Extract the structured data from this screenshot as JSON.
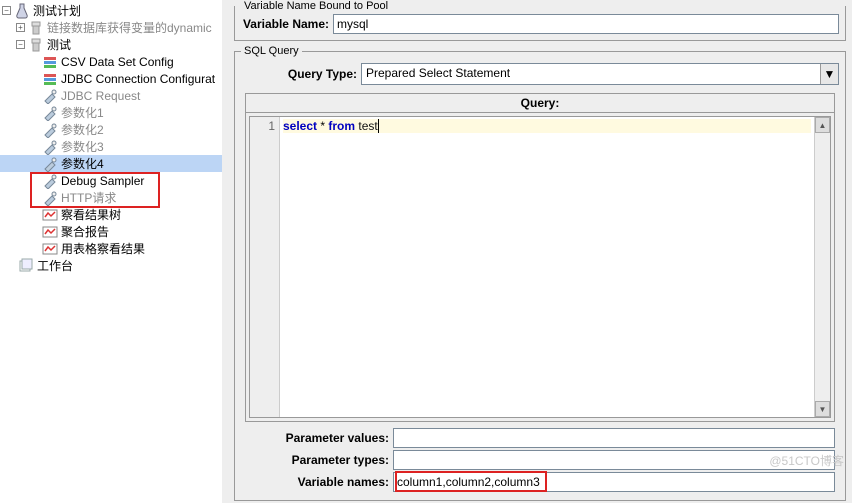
{
  "tree": {
    "root_label": "测试计划",
    "dynamic_label": "链接数据库获得变量的dynamic",
    "test_label": "测试",
    "csv_label": "CSV Data Set Config",
    "jdbc_conn_label": "JDBC Connection Configurat",
    "jdbc_req_label": "JDBC Request",
    "param1_label": "参数化1",
    "param2_label": "参数化2",
    "param3_label": "参数化3",
    "param4_label": "参数化4",
    "debug_label": "Debug Sampler",
    "http_label": "HTTP请求",
    "result_tree_label": "察看结果树",
    "aggregate_label": "聚合报告",
    "table_results_label": "用表格察看结果",
    "workbench_label": "工作台"
  },
  "pool_legend": "Variable Name Bound to Pool",
  "var_name_label": "Variable Name:",
  "var_name_value": "mysql",
  "sql_legend": "SQL Query",
  "query_type_label": "Query Type:",
  "query_type_value": "Prepared Select Statement",
  "query_header": "Query:",
  "gutter_1": "1",
  "code_kw1": "select",
  "code_op": " * ",
  "code_kw2": "from",
  "code_id": " test",
  "param_values_label": "Parameter values:",
  "param_values_value": "",
  "param_types_label": "Parameter types:",
  "param_types_value": "",
  "var_names_label": "Variable names:",
  "var_names_value": "column1,column2,column3",
  "watermark": "@51CTO博客"
}
